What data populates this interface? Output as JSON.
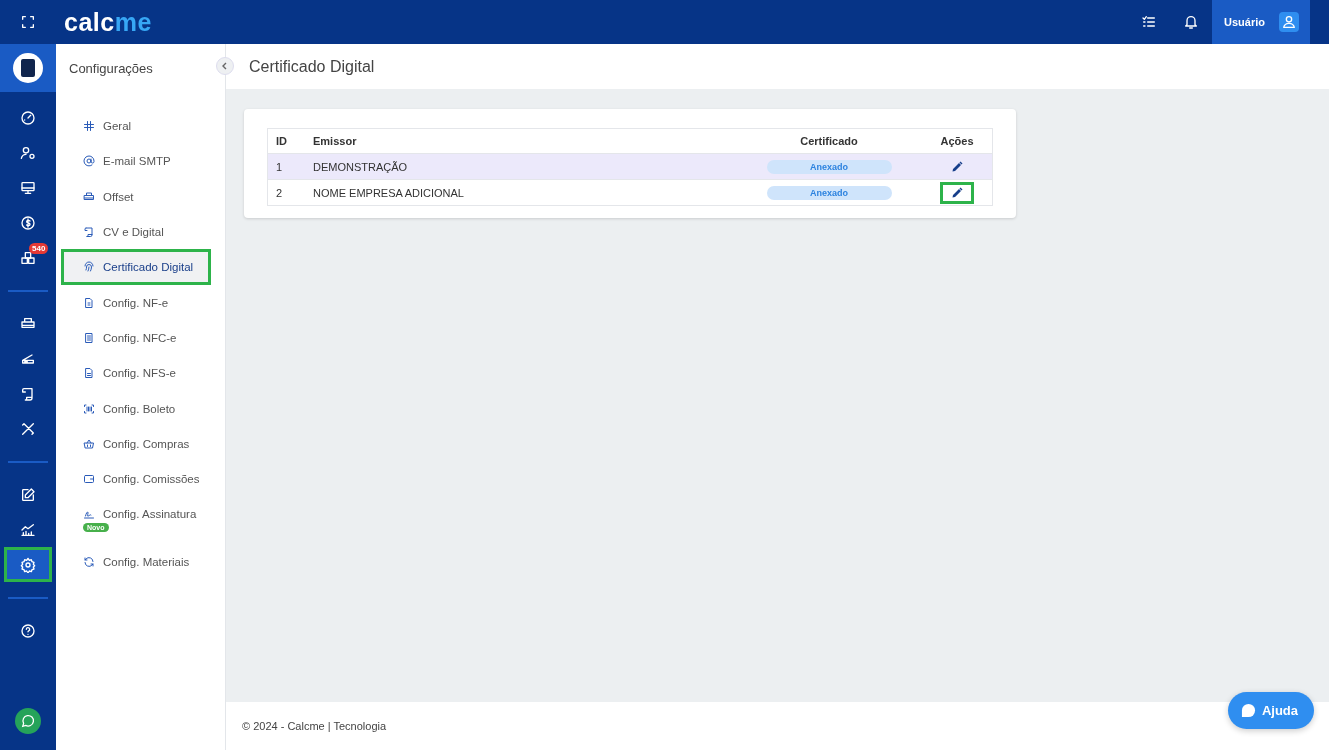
{
  "topbar": {
    "logo": {
      "text": "calc",
      "accent": "me"
    },
    "user": {
      "label": "Usuário"
    }
  },
  "rail": {
    "items": [
      {
        "kind": "avatar"
      },
      {
        "kind": "link",
        "selected": false,
        "highlighted": false
      },
      {
        "kind": "link",
        "selected": false,
        "highlighted": false
      },
      {
        "kind": "link",
        "selected": false,
        "highlighted": false
      },
      {
        "kind": "link",
        "selected": false,
        "highlighted": false
      },
      {
        "kind": "link",
        "selected": false,
        "highlighted": false,
        "badge": "540"
      },
      {
        "kind": "divider"
      },
      {
        "kind": "link",
        "selected": false,
        "highlighted": false
      },
      {
        "kind": "link",
        "selected": false,
        "highlighted": false
      },
      {
        "kind": "link",
        "selected": false,
        "highlighted": false
      },
      {
        "kind": "link",
        "selected": false,
        "highlighted": false
      },
      {
        "kind": "divider"
      },
      {
        "kind": "link",
        "selected": false,
        "highlighted": false
      },
      {
        "kind": "link",
        "selected": false,
        "highlighted": false
      },
      {
        "kind": "link",
        "selected": true,
        "highlighted": true
      },
      {
        "kind": "divider"
      },
      {
        "kind": "link",
        "selected": false,
        "highlighted": false
      }
    ]
  },
  "submenu": {
    "title": "Configurações",
    "items": [
      {
        "label": "Geral",
        "selected": false,
        "highlighted": false
      },
      {
        "label": "E-mail SMTP",
        "selected": false,
        "highlighted": false
      },
      {
        "label": "Offset",
        "selected": false,
        "highlighted": false
      },
      {
        "label": "CV e Digital",
        "selected": false,
        "highlighted": false
      },
      {
        "label": "Certificado Digital",
        "selected": true,
        "highlighted": true
      },
      {
        "label": "Config. NF-e",
        "selected": false,
        "highlighted": false
      },
      {
        "label": "Config. NFC-e",
        "selected": false,
        "highlighted": false
      },
      {
        "label": "Config. NFS-e",
        "selected": false,
        "highlighted": false
      },
      {
        "label": "Config. Boleto",
        "selected": false,
        "highlighted": false
      },
      {
        "label": "Config. Compras",
        "selected": false,
        "highlighted": false
      },
      {
        "label": "Config. Comissões",
        "selected": false,
        "highlighted": false
      },
      {
        "label": "Config. Assinatura",
        "selected": false,
        "highlighted": false,
        "badge": "Novo"
      },
      {
        "label": "Config. Materiais",
        "selected": false,
        "highlighted": false
      }
    ]
  },
  "page": {
    "title": "Certificado Digital"
  },
  "table": {
    "columns": [
      "ID",
      "Emissor",
      "Certificado",
      "Ações"
    ],
    "rows": [
      {
        "id": "1",
        "emissor": "DEMONSTRAÇÃO",
        "certificado": "Anexado",
        "shaded": true,
        "edit_highlighted": false
      },
      {
        "id": "2",
        "emissor": "NOME EMPRESA ADICIONAL",
        "certificado": "Anexado",
        "shaded": false,
        "edit_highlighted": true
      }
    ]
  },
  "footer": {
    "text": "© 2024 - Calcme | Tecnologia"
  },
  "help_button": {
    "label": "Ajuda"
  }
}
